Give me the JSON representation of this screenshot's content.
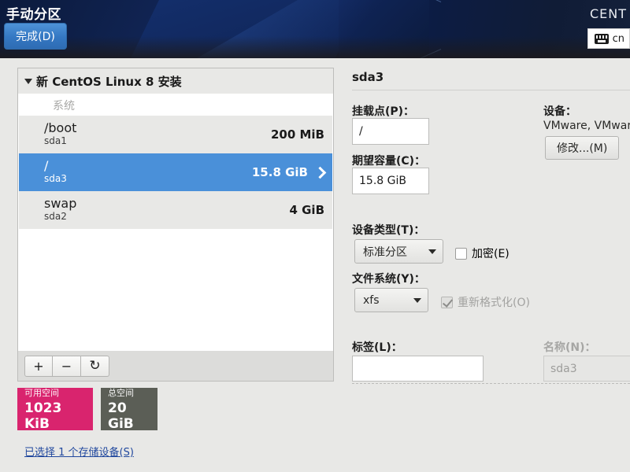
{
  "header": {
    "title": "手动分区",
    "done_button": "完成(D)",
    "brand": "CENT",
    "keyboard_icon": "keyboard-icon",
    "keyboard_layout": "cn"
  },
  "partition_list": {
    "tree_header": "新 CentOS Linux 8 安装",
    "group_label": "系统",
    "rows": [
      {
        "mount": "/boot",
        "device": "sda1",
        "size": "200 MiB",
        "selected": false
      },
      {
        "mount": "/",
        "device": "sda3",
        "size": "15.8 GiB",
        "selected": true
      },
      {
        "mount": "swap",
        "device": "sda2",
        "size": "4 GiB",
        "selected": false
      }
    ],
    "toolbar": {
      "add": "+",
      "remove": "−",
      "refresh": "↻"
    }
  },
  "summary": {
    "free_caption": "可用空间",
    "free_value": "1023 KiB",
    "free_color": "#d9246e",
    "total_caption": "总空间",
    "total_value": "20 GiB",
    "total_color": "#5b5e56",
    "device_link": "已选择 1 个存储设备(S)"
  },
  "details": {
    "title": "sda3",
    "mount_point_label": "挂载点(P)：",
    "mount_point_value": "/",
    "capacity_label": "期望容量(C)：",
    "capacity_value": "15.8 GiB",
    "device_type_label": "设备类型(T)：",
    "device_type_value": "标准分区",
    "encrypt_label": "加密(E)",
    "filesystem_label": "文件系统(Y)：",
    "filesystem_value": "xfs",
    "reformat_label": "重新格式化(O)",
    "tag_label": "标签(L)：",
    "tag_value": "",
    "name_label": "名称(N)：",
    "name_value": "sda3",
    "device_label": "设备：",
    "device_model": "VMware, VMware V",
    "modify_button": "修改...(M)"
  },
  "colors": {
    "selection_blue": "#4a90d9",
    "accent_button": "#3477c2",
    "panel_bg": "#e8e8e6"
  }
}
